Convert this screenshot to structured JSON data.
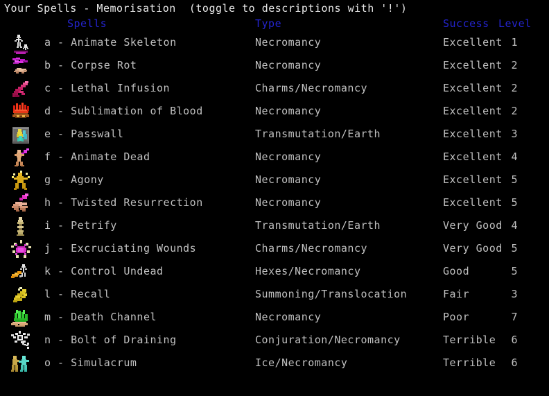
{
  "window": {
    "title": "Your Spells - Memorisation  (toggle to descriptions with '!')",
    "background_color": "#000000",
    "text_color": "#c0c0c0",
    "header_color": "#2424d0"
  },
  "columns": {
    "spells": "Spells",
    "type": "Type",
    "success": "Success",
    "level": "Level"
  },
  "spells": [
    {
      "letter": "a",
      "name": "a - Animate Skeleton",
      "type": "Necromancy",
      "success": "Excellent",
      "level": "1",
      "icon": "animate-skeleton-icon"
    },
    {
      "letter": "b",
      "name": "b - Corpse Rot",
      "type": "Necromancy",
      "success": "Excellent",
      "level": "2",
      "icon": "corpse-rot-icon"
    },
    {
      "letter": "c",
      "name": "c - Lethal Infusion",
      "type": "Charms/Necromancy",
      "success": "Excellent",
      "level": "2",
      "icon": "lethal-infusion-icon"
    },
    {
      "letter": "d",
      "name": "d - Sublimation of Blood",
      "type": "Necromancy",
      "success": "Excellent",
      "level": "2",
      "icon": "sublimation-of-blood-icon"
    },
    {
      "letter": "e",
      "name": "e - Passwall",
      "type": "Transmutation/Earth",
      "success": "Excellent",
      "level": "3",
      "icon": "passwall-icon"
    },
    {
      "letter": "f",
      "name": "f - Animate Dead",
      "type": "Necromancy",
      "success": "Excellent",
      "level": "4",
      "icon": "animate-dead-icon"
    },
    {
      "letter": "g",
      "name": "g - Agony",
      "type": "Necromancy",
      "success": "Excellent",
      "level": "5",
      "icon": "agony-icon"
    },
    {
      "letter": "h",
      "name": "h - Twisted Resurrection",
      "type": "Necromancy",
      "success": "Excellent",
      "level": "5",
      "icon": "twisted-resurrection-icon"
    },
    {
      "letter": "i",
      "name": "i - Petrify",
      "type": "Transmutation/Earth",
      "success": "Very Good",
      "level": "4",
      "icon": "petrify-icon"
    },
    {
      "letter": "j",
      "name": "j - Excruciating Wounds",
      "type": "Charms/Necromancy",
      "success": "Very Good",
      "level": "5",
      "icon": "excruciating-wounds-icon"
    },
    {
      "letter": "k",
      "name": "k - Control Undead",
      "type": "Hexes/Necromancy",
      "success": "Good",
      "level": "5",
      "icon": "control-undead-icon"
    },
    {
      "letter": "l",
      "name": "l - Recall",
      "type": "Summoning/Translocation",
      "success": "Fair",
      "level": "3",
      "icon": "recall-icon"
    },
    {
      "letter": "m",
      "name": "m - Death Channel",
      "type": "Necromancy",
      "success": "Poor",
      "level": "7",
      "icon": "death-channel-icon"
    },
    {
      "letter": "n",
      "name": "n - Bolt of Draining",
      "type": "Conjuration/Necromancy",
      "success": "Terrible",
      "level": "6",
      "icon": "bolt-of-draining-icon"
    },
    {
      "letter": "o",
      "name": "o - Simulacrum",
      "type": "Ice/Necromancy",
      "success": "Terrible",
      "level": "6",
      "icon": "simulacrum-icon"
    }
  ]
}
